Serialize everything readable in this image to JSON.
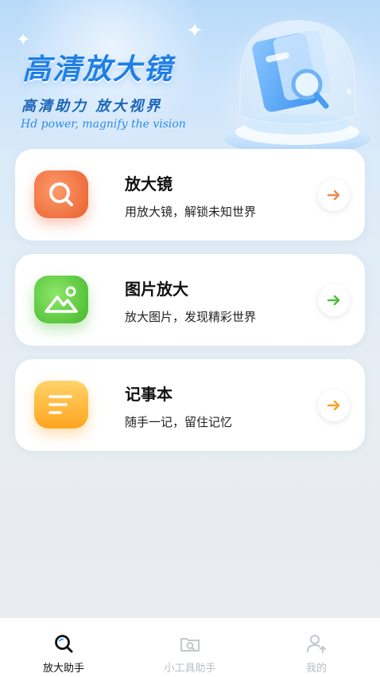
{
  "hero": {
    "title": "高清放大镜",
    "subtitle": "高清助力  放大视界",
    "tagline": "Hd power, magnify the vision"
  },
  "cards": [
    {
      "title": "放大镜",
      "desc": "用放大镜，解锁未知世界",
      "icon": "magnifier-icon",
      "color": "#f07a4a",
      "arrow_color": "#f2894f"
    },
    {
      "title": "图片放大",
      "desc": "放大图片，发现精彩世界",
      "icon": "image-icon",
      "color": "#5ccc3a",
      "arrow_color": "#4cbf3a"
    },
    {
      "title": "记事本",
      "desc": "随手一记，留住记忆",
      "icon": "note-icon",
      "color": "#ffb62e",
      "arrow_color": "#f5a623"
    }
  ],
  "tabs": [
    {
      "label": "放大助手",
      "icon": "search-icon",
      "active": true
    },
    {
      "label": "小工具助手",
      "icon": "camera-folder-icon",
      "active": false
    },
    {
      "label": "我的",
      "icon": "user-icon",
      "active": false
    }
  ],
  "colors": {
    "primary_text": "#111111",
    "inactive_tab": "#b8bcc4",
    "hero_blue": "#1f7fe6"
  }
}
